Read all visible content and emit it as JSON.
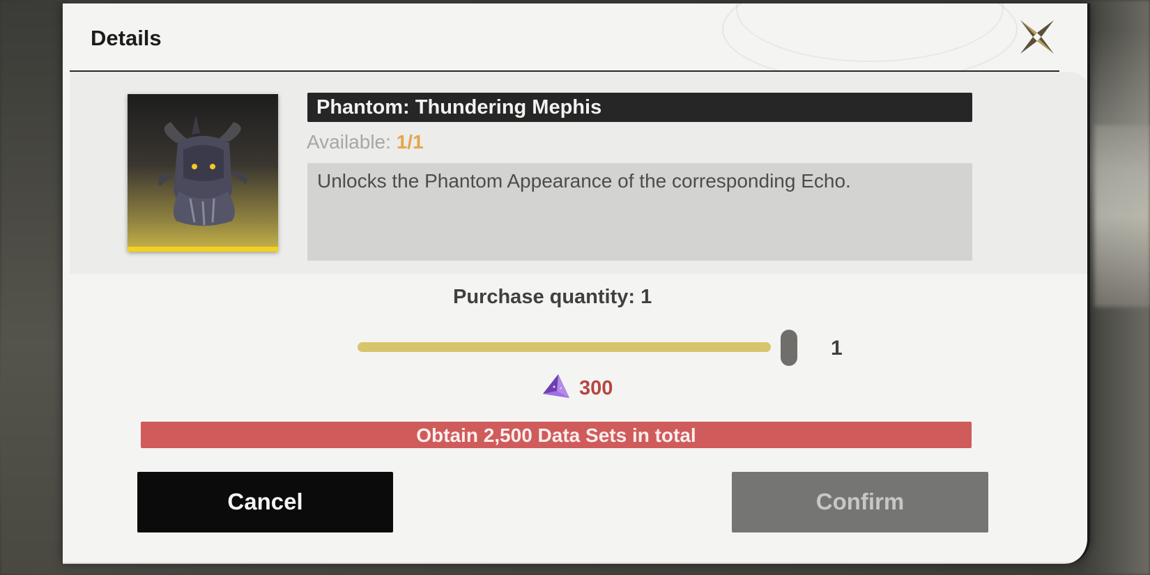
{
  "dialog": {
    "title": "Details",
    "close_icon": "close-x-icon"
  },
  "item": {
    "name": "Phantom: Thundering Mephis",
    "available_label": "Available: ",
    "available_value": "1/1",
    "description": "Unlocks the Phantom Appearance of the corresponding Echo.",
    "portrait_icon": "phantom-mephis-portrait"
  },
  "purchase": {
    "quantity_label": "Purchase quantity: 1",
    "slider_value": "1",
    "slider_level": 1.0,
    "currency_icon": "purple-crystal-icon",
    "cost": "300",
    "requirement": "Obtain 2,500 Data Sets in total"
  },
  "buttons": {
    "cancel": "Cancel",
    "confirm": "Confirm"
  },
  "colors": {
    "accent_gold": "#d8c46b",
    "warning_red": "#cf5b5b",
    "cost_red": "#b8453f",
    "available_orange": "#e4a547"
  }
}
